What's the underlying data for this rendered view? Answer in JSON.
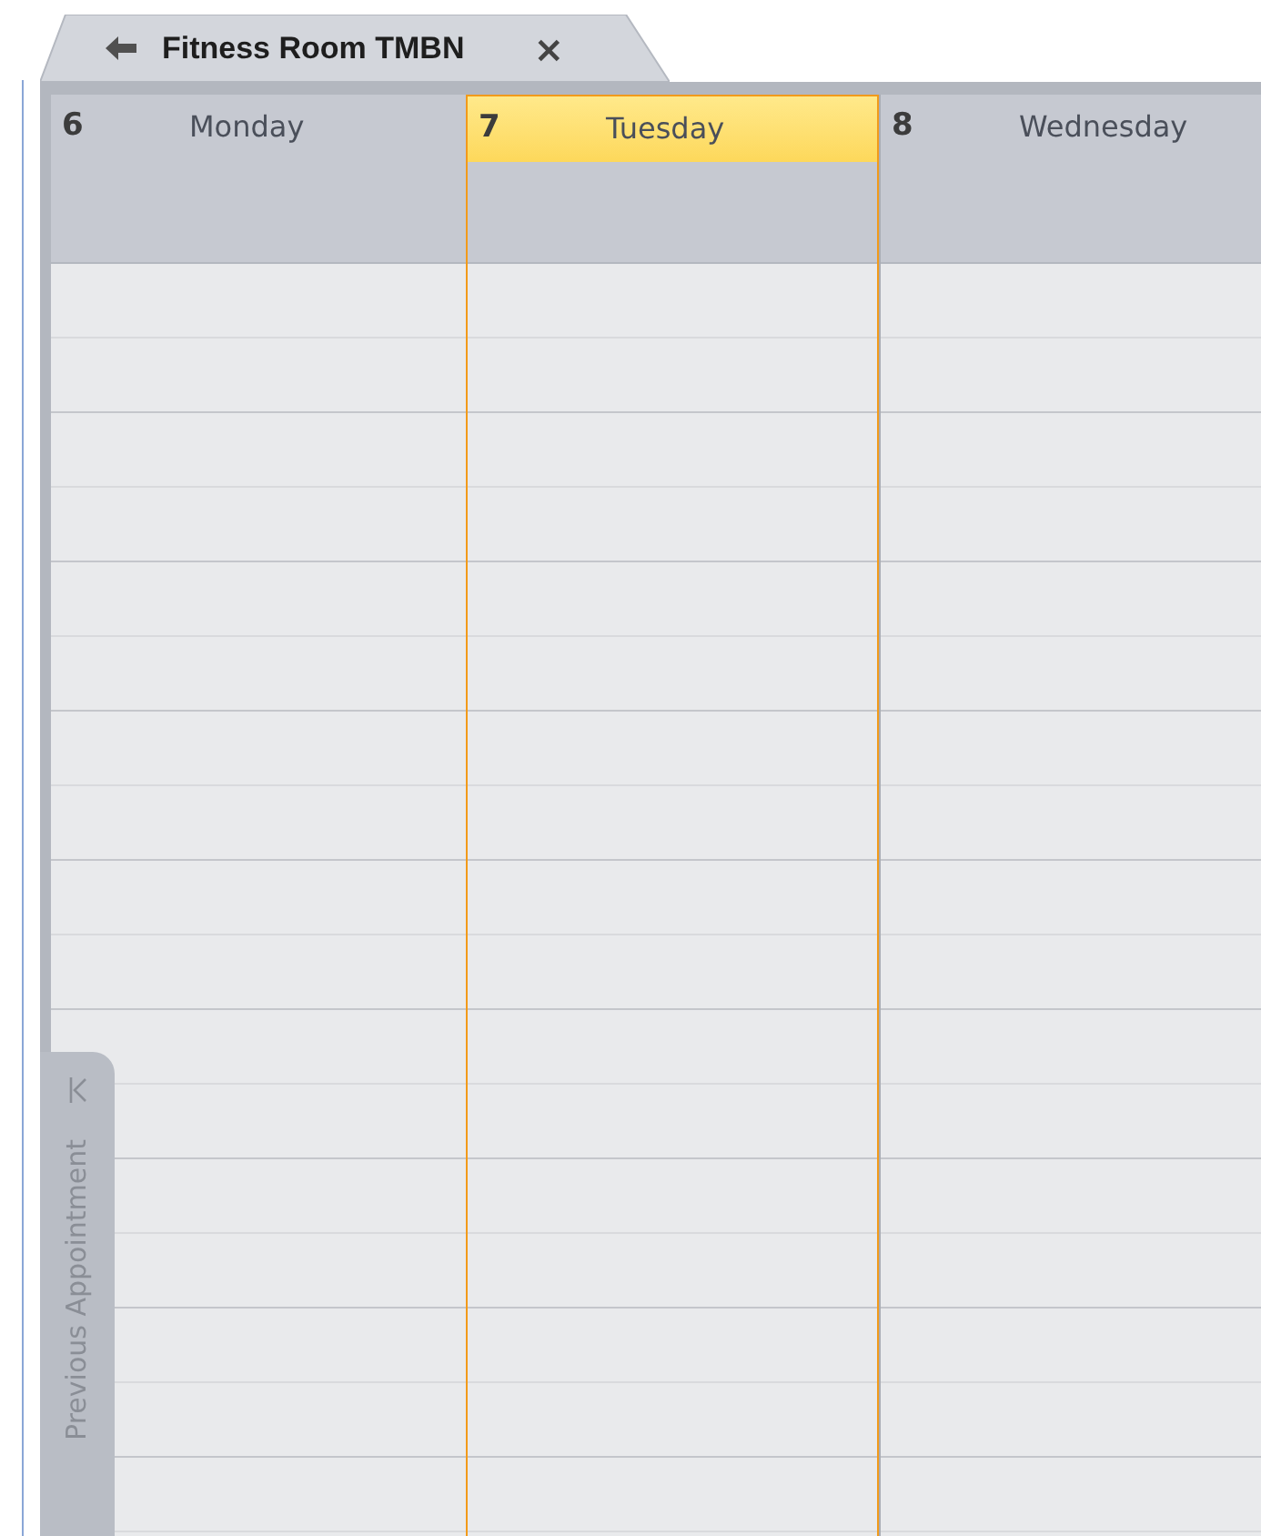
{
  "tab": {
    "title": "Fitness Room TMBN",
    "close": "×"
  },
  "days": [
    {
      "number": "6",
      "name": "Monday",
      "selected": false
    },
    {
      "number": "7",
      "name": "Tuesday",
      "selected": true
    },
    {
      "number": "8",
      "name": "Wednesday",
      "selected": false
    }
  ],
  "previous_appointment": {
    "label": "Previous Appointment"
  }
}
